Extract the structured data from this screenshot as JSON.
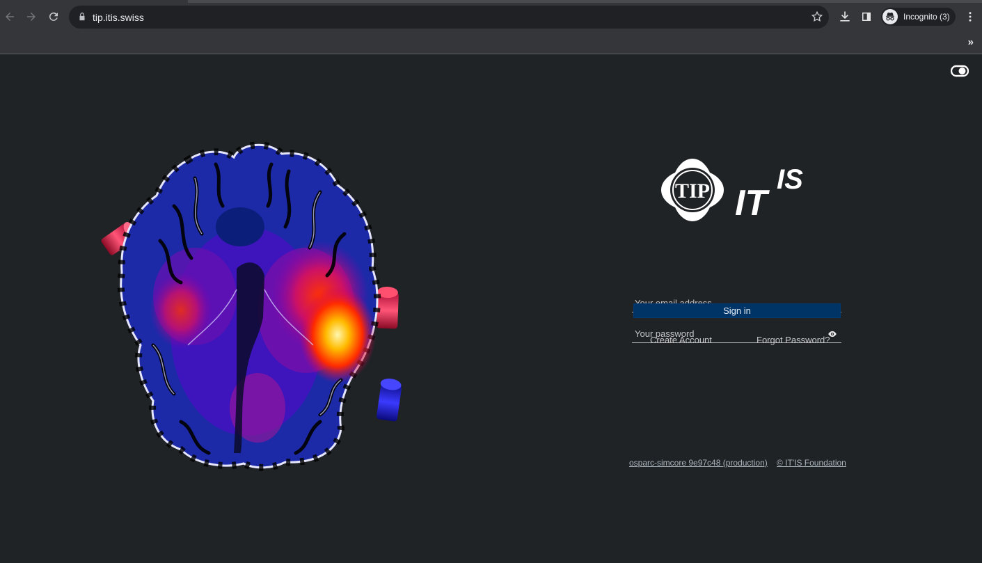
{
  "browser": {
    "url": "tip.itis.swiss",
    "profile_label": "Incognito (3)",
    "bookmarks_more": "»"
  },
  "login": {
    "email_placeholder": "Your email address",
    "password_placeholder": "Your password",
    "signin_label": "Sign in",
    "create_account_label": "Create Account",
    "forgot_password_label": "Forgot Password?"
  },
  "logo": {
    "tip_text": "TIP",
    "itis_text": "IT'IS"
  },
  "footer": {
    "version_link": "osparc-simcore 9e97c48 (production)",
    "copyright_link": "© IT'IS Foundation"
  },
  "colors": {
    "background": "#202326",
    "signin_button": "#003366",
    "chrome": "#35363a"
  }
}
